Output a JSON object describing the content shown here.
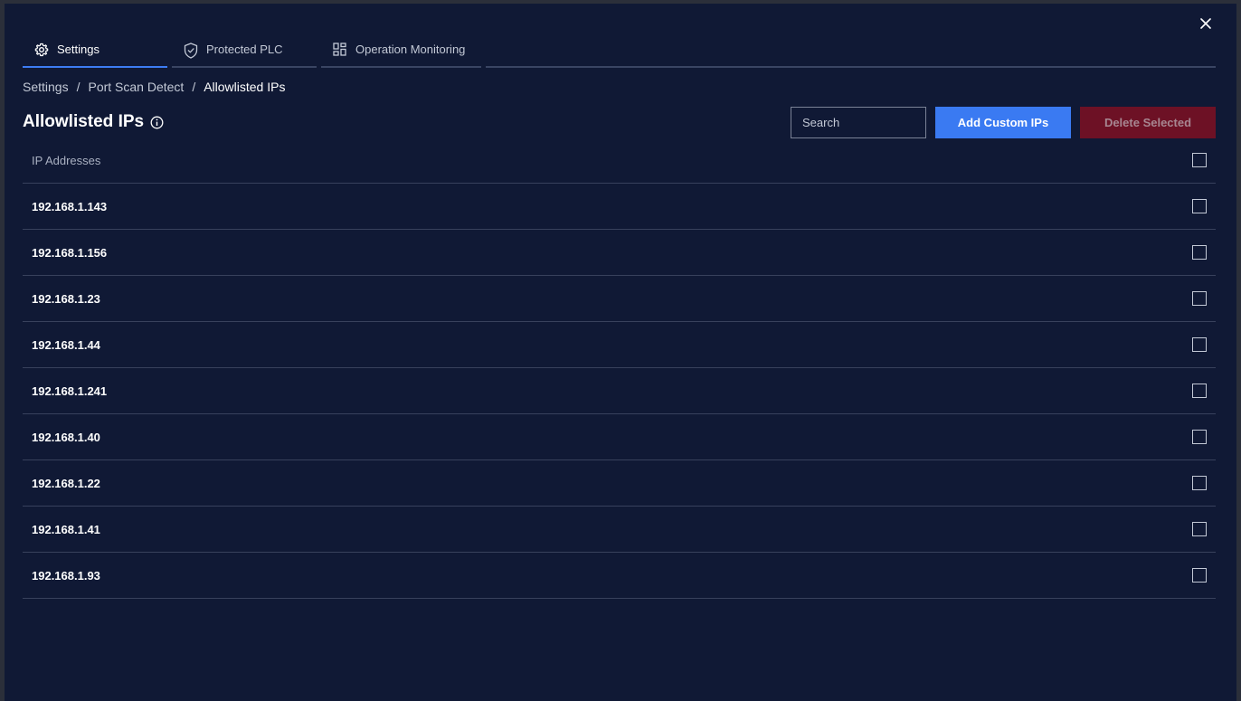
{
  "tabs": [
    {
      "label": "Settings",
      "icon": "gear-icon",
      "active": true
    },
    {
      "label": "Protected PLC",
      "icon": "shield-check-icon",
      "active": false
    },
    {
      "label": "Operation Monitoring",
      "icon": "dashboard-grid-icon",
      "active": false
    }
  ],
  "breadcrumb": {
    "items": [
      "Settings",
      "Port Scan Detect",
      "Allowlisted IPs"
    ],
    "separator": "/"
  },
  "page": {
    "title": "Allowlisted IPs"
  },
  "search": {
    "placeholder": "Search",
    "value": ""
  },
  "actions": {
    "add_label": "Add Custom IPs",
    "delete_label": "Delete Selected"
  },
  "table": {
    "column_header": "IP Addresses",
    "rows": [
      "192.168.1.143",
      "192.168.1.156",
      "192.168.1.23",
      "192.168.1.44",
      "192.168.1.241",
      "192.168.1.40",
      "192.168.1.22",
      "192.168.1.41",
      "192.168.1.93"
    ]
  },
  "colors": {
    "background": "#101935",
    "accent": "#3a7af2",
    "danger": "#6d1125",
    "divider": "#38415c"
  }
}
